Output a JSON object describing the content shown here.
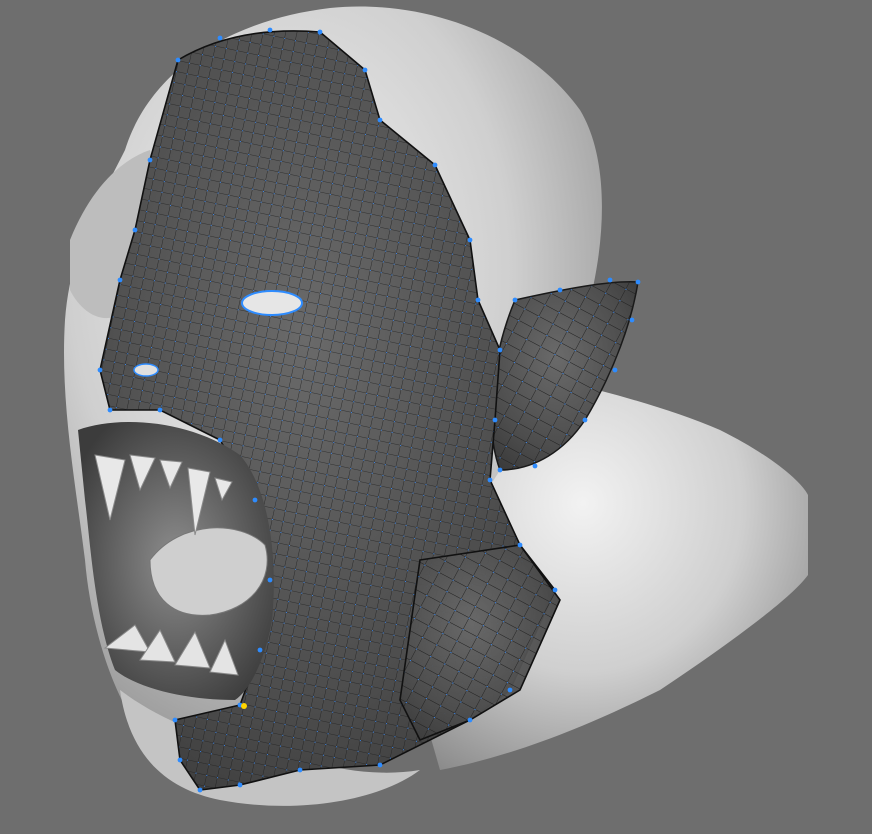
{
  "viewport": {
    "background_color": "#6e6e6e",
    "model_color": "#d2d2d2",
    "retopo_mesh_color": "#4a4a4a",
    "wire_color": "#1a1a1a",
    "vertex_color": "#2e8cff",
    "active_vertex_color": "#ffd400"
  }
}
